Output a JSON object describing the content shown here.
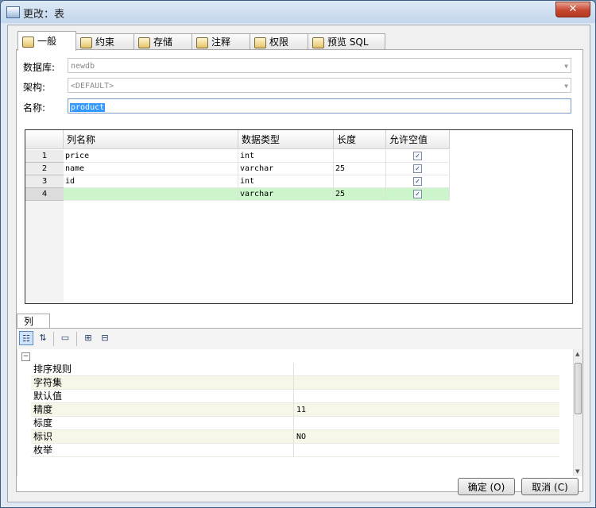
{
  "window": {
    "title": "更改：表",
    "close_label": "✕"
  },
  "tabs": [
    {
      "label": "一般",
      "active": true
    },
    {
      "label": "约束",
      "active": false
    },
    {
      "label": "存储",
      "active": false
    },
    {
      "label": "注释",
      "active": false
    },
    {
      "label": "权限",
      "active": false
    },
    {
      "label": "预览 SQL",
      "active": false
    }
  ],
  "form": {
    "database_label": "数据库:",
    "database_value": "newdb",
    "schema_label": "架构:",
    "schema_value": "<DEFAULT>",
    "name_label": "名称:",
    "name_value": "product"
  },
  "columns_grid": {
    "headers": [
      "列名称",
      "数据类型",
      "长度",
      "允许空值"
    ],
    "rows": [
      {
        "num": "1",
        "name": "price",
        "type": "int",
        "length": "",
        "nullable": true
      },
      {
        "num": "2",
        "name": "name",
        "type": "varchar",
        "length": "25",
        "nullable": true
      },
      {
        "num": "3",
        "name": "id",
        "type": "int",
        "length": "",
        "nullable": true
      },
      {
        "num": "4",
        "name": "",
        "type": "varchar",
        "length": "25",
        "nullable": true,
        "selected": true
      }
    ],
    "selected_row_color": "#ccf5cc"
  },
  "properties": {
    "tab_label": "列",
    "collapse_glyph": "−",
    "rows": [
      {
        "key": "排序规则",
        "value": ""
      },
      {
        "key": "字符集",
        "value": ""
      },
      {
        "key": "默认值",
        "value": ""
      },
      {
        "key": "精度",
        "value": "11"
      },
      {
        "key": "标度",
        "value": ""
      },
      {
        "key": "标识",
        "value": "NO"
      },
      {
        "key": "枚举",
        "value": ""
      }
    ],
    "stripe_color": "#f7f7e9"
  },
  "buttons": {
    "ok": "确定 (O)",
    "cancel": "取消 (C)"
  },
  "icons": [
    "table-icon",
    "key-icon",
    "storage-icon",
    "comment-icon",
    "permission-icon",
    "preview-sql-icon",
    "categorized-icon",
    "sort-alpha-icon",
    "property-pages-icon",
    "expand-icon",
    "collapse-icon"
  ]
}
